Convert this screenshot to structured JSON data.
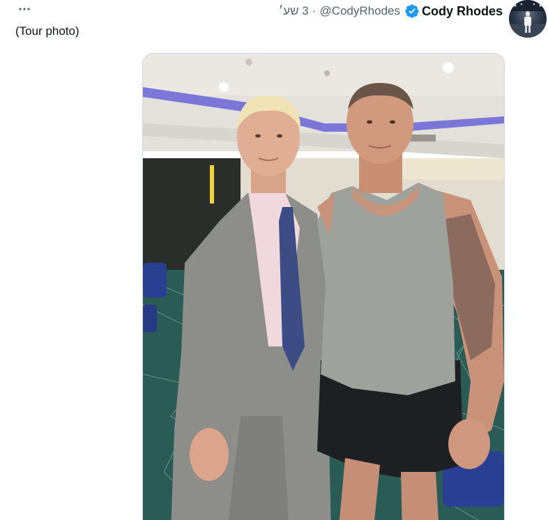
{
  "tweet": {
    "text": "(Tour photo)",
    "more_icon": "more-horizontal-icon"
  },
  "author": {
    "display_name": "Cody Rhodes",
    "handle": "@CodyRhodes",
    "verified_icon": "verified-badge-icon",
    "verified_color": "#1d9bf0"
  },
  "meta": {
    "separator": "·",
    "time": "3 שע׳"
  },
  "colors": {
    "text": "#0f1419",
    "secondary": "#536471",
    "border": "#cfd9de"
  }
}
